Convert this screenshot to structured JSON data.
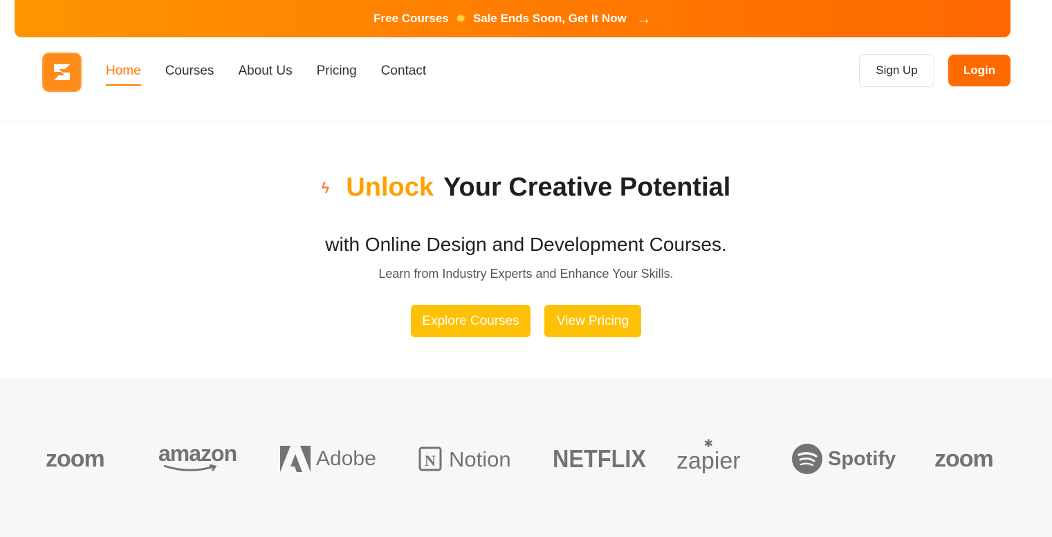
{
  "promo": {
    "text_left": "Free Courses",
    "sun_icon": "sun-icon",
    "text_right": "Sale Ends Soon, Get It Now",
    "arrow_icon": "arrow-right-icon"
  },
  "nav": {
    "logo_icon": "brand-logo-icon",
    "links": [
      {
        "label": "Home",
        "active": true
      },
      {
        "label": "Courses",
        "active": false
      },
      {
        "label": "About Us",
        "active": false
      },
      {
        "label": "Pricing",
        "active": false
      },
      {
        "label": "Contact",
        "active": false
      }
    ],
    "signup_label": "Sign Up",
    "login_label": "Login"
  },
  "hero": {
    "bolt_icon": "lightning-icon",
    "title_accent": "Unlock",
    "title_rest": "Your Creative Potential",
    "subtitle": "with Online Design and Development Courses.",
    "description": "Learn from Industry Experts and Enhance Your Skills.",
    "explore_label": "Explore Courses",
    "pricing_label": "View Pricing"
  },
  "brands": {
    "logos": [
      "zoom",
      "amazon",
      "Adobe",
      "Notion",
      "NETFLIX",
      "zapier",
      "Spotify",
      "zoom"
    ]
  },
  "colors": {
    "primary": "#ff7a00",
    "login": "#ff6a00",
    "cta_yellow": "#ffc107",
    "accent_text": "#ffa000",
    "logo_gray": "#737373"
  }
}
